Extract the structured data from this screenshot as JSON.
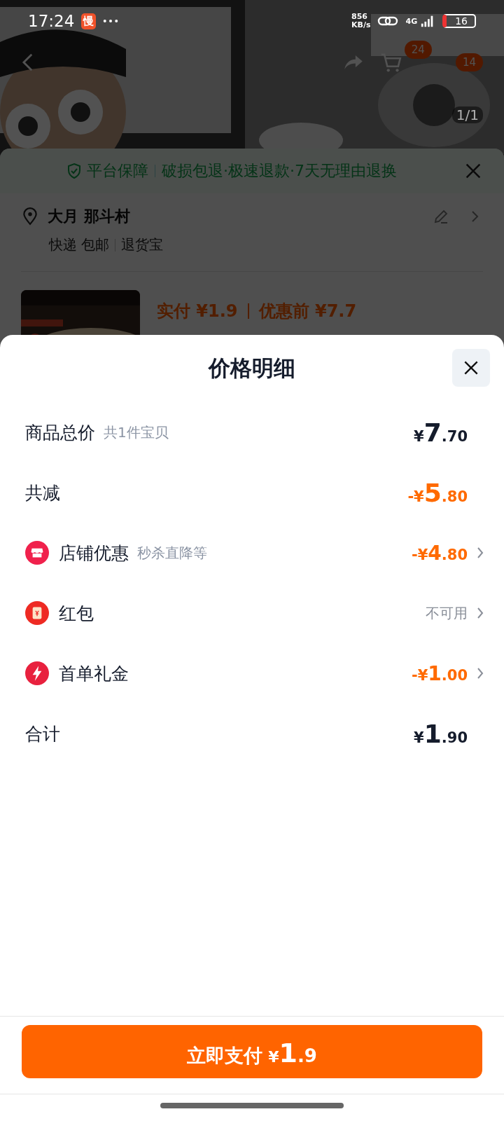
{
  "status_bar": {
    "time": "17:24",
    "notification_badge": "慢",
    "net_speed_value": "856",
    "net_speed_unit": "KB/s",
    "network": "4G",
    "battery": "16"
  },
  "product_nav": {
    "cart_badge": "24",
    "message_badge": "14",
    "image_counter": "1/1"
  },
  "order": {
    "guarantee": {
      "title": "平台保障",
      "terms": "破损包退·极速退款·7天无理由退换"
    },
    "address": {
      "name": "大月 那斗村"
    },
    "shipping": "快递 包邮",
    "service": "退货宝",
    "product": {
      "paid_label": "实付",
      "paid": "¥1.9",
      "original_label": "优惠前",
      "original": "¥7.7"
    }
  },
  "price_detail": {
    "title": "价格明细",
    "rows": [
      {
        "kind": "summary",
        "label": "商品总价",
        "note": "共1件宝贝",
        "amount": "¥7.70",
        "color": "#151c2c",
        "expandable": false
      },
      {
        "kind": "summary",
        "label": "共减",
        "amount": "-¥5.80",
        "color": "#ff6a00",
        "expandable": false
      },
      {
        "kind": "shop",
        "label": "店铺优惠",
        "note": "秒杀直降等",
        "amount": "-¥4.80",
        "color": "#ff6a00",
        "expandable": true
      },
      {
        "kind": "envelope",
        "label": "红包",
        "amount": "不可用",
        "color": "#8a8f99",
        "expandable": true
      },
      {
        "kind": "flash",
        "label": "首单礼金",
        "amount": "-¥1.00",
        "color": "#ff6a00",
        "expandable": true
      },
      {
        "kind": "summary",
        "label": "合计",
        "amount": "¥1.90",
        "color": "#151c2c",
        "expandable": false
      }
    ]
  },
  "pay_button": {
    "label": "立即支付",
    "amount": "¥1.9"
  }
}
